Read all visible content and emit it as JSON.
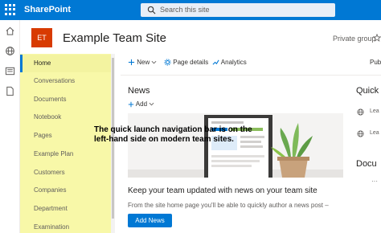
{
  "suite_bar": {
    "app_name": "SharePoint",
    "search_placeholder": "Search this site"
  },
  "site": {
    "logo_initials": "ET",
    "title": "Example Team Site",
    "privacy": "Private group"
  },
  "quick_launch": {
    "items": [
      {
        "label": "Home",
        "selected": true
      },
      {
        "label": "Conversations"
      },
      {
        "label": "Documents"
      },
      {
        "label": "Notebook"
      },
      {
        "label": "Pages"
      },
      {
        "label": "Example Plan"
      },
      {
        "label": "Customers"
      },
      {
        "label": "Companies"
      },
      {
        "label": "Department"
      },
      {
        "label": "Examination"
      }
    ]
  },
  "command_bar": {
    "new_label": "New",
    "page_details_label": "Page details",
    "analytics_label": "Analytics",
    "publish_label_partial": "Publ"
  },
  "news": {
    "title": "News",
    "add_label": "Add",
    "headline": "Keep your team updated with news on your team site",
    "description": "From the site home page you'll be able to quickly author a news post –",
    "add_news_button": "Add News"
  },
  "quick_links": {
    "title_partial": "Quick",
    "link1_partial": "Lea",
    "link2_partial": "Lea"
  },
  "documents": {
    "title_partial": "Docu",
    "more": "···"
  },
  "annotation": {
    "line1": "The quick launch navigation bar is on the",
    "line2": "left-hand side on modern team sites."
  },
  "colors": {
    "suite_bar": "#0078d4",
    "quick_launch_highlight": "#f8f8a8",
    "site_logo": "#d83b01",
    "primary_button": "#0078d4"
  }
}
